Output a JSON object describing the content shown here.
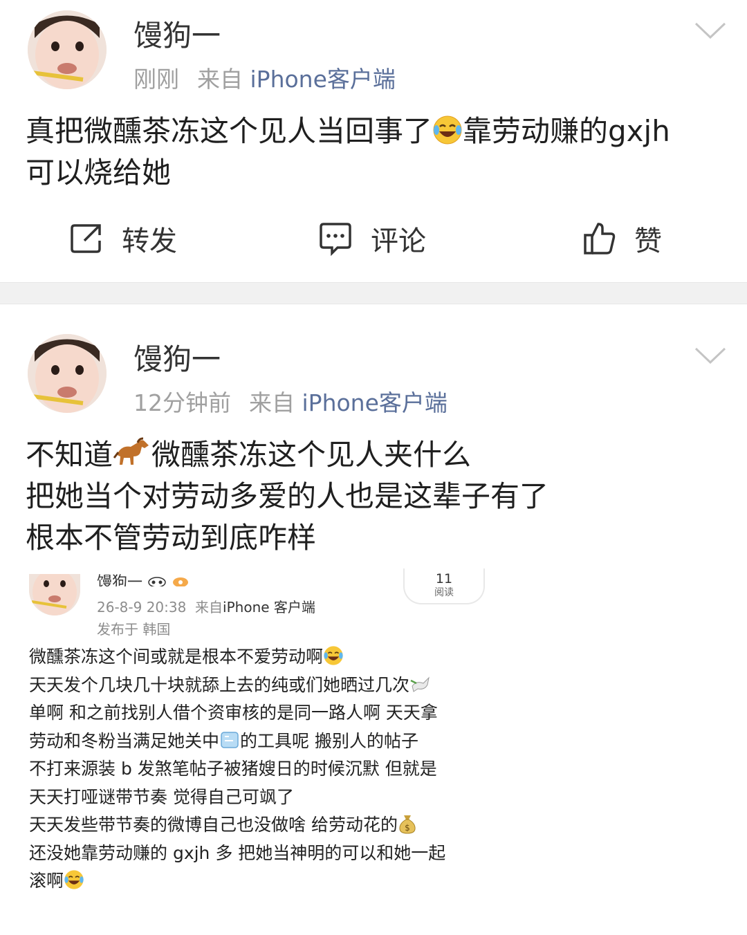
{
  "posts": [
    {
      "username": "馒狗一",
      "time": "刚刚",
      "source_prefix": "来自",
      "source": "iPhone客户端",
      "content_line1_a": "真把微醺茶冻这个见人当回事了",
      "content_line1_b": "靠劳动赚的gxjh",
      "content_line2": "可以烧给她",
      "actions": {
        "repost": "转发",
        "comment": "评论",
        "like": "赞"
      }
    },
    {
      "username": "馒狗一",
      "time": "12分钟前",
      "source_prefix": "来自",
      "source": "iPhone客户端",
      "content_line1_a": "不知道",
      "content_line1_b": "微醺茶冻这个见人夹什么",
      "content_line2": "把她当个对劳动多爱的人也是这辈子有了",
      "content_line3": "根本不管劳动到底咋样"
    }
  ],
  "embedded": {
    "username": "馒狗一",
    "datetime": "26-8-9 20:38",
    "source_prefix": "来自",
    "source": "iPhone 客户端",
    "location": "发布于 韩国",
    "reads_count": "11",
    "reads_label": "阅读",
    "lines": [
      "微醺茶冻这个间或就是根本不爱劳动啊",
      "天天发个几块几十块就舔上去的纯或们她晒过几次",
      "单啊 和之前找别人借个资审核的是同一路人啊 天天拿",
      "劳动和冬粉当满足她关中",
      "的工具呢 搬别人的帖子",
      "不打来源装 b 发煞笔帖子被猪嫂日的时候沉默 但就是",
      "天天打哑谜带节奏 觉得自己可飒了",
      "天天发些带节奏的微博自己也没做啥 给劳动花的",
      "还没她靠劳动赚的 gxjh 多 把她当神明的可以和她一起",
      "滚啊"
    ]
  },
  "icons": {
    "laugh": "face-with-tears-of-joy-icon",
    "horse": "horse-icon",
    "dove": "dove-icon",
    "ice": "ice-cube-icon",
    "money": "money-bag-icon"
  },
  "colors": {
    "source_link": "#5a6f9a",
    "meta_gray": "#a0a0a0",
    "divider": "#f1f1f1"
  }
}
